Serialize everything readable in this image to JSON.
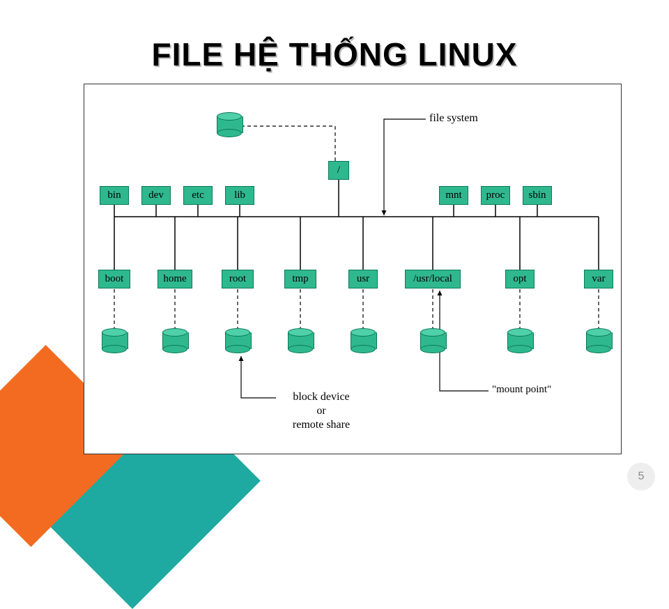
{
  "title": "FILE HỆ THỐNG LINUX",
  "page_number": "5",
  "nodes": {
    "root": "/",
    "row1": [
      "bin",
      "dev",
      "etc",
      "lib",
      "mnt",
      "proc",
      "sbin"
    ],
    "row2": [
      "boot",
      "home",
      "root",
      "tmp",
      "usr",
      "/usr/local",
      "opt",
      "var"
    ]
  },
  "labels": {
    "file_system": "file system",
    "block_device_1": "block device",
    "block_device_2": "or",
    "block_device_3": "remote share",
    "mount_point": "\"mount point\""
  }
}
